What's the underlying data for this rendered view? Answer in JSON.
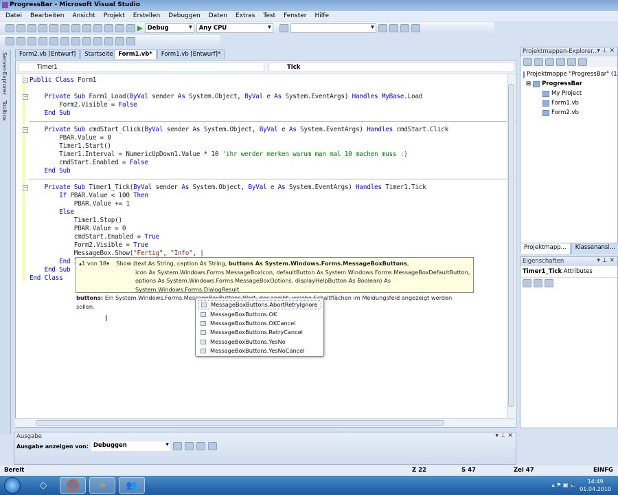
{
  "window": {
    "title": "ProgressBar - Microsoft Visual Studio"
  },
  "menu": [
    "Datei",
    "Bearbeiten",
    "Ansicht",
    "Projekt",
    "Erstellen",
    "Debuggen",
    "Daten",
    "Extras",
    "Test",
    "Fenster",
    "Hilfe"
  ],
  "toolbar": {
    "config": "Debug",
    "platform": "Any CPU"
  },
  "left_strip": [
    "Server-Explorer",
    "Toolbox"
  ],
  "tabs": [
    {
      "label": "Form2.vb [Entwurf]",
      "active": false
    },
    {
      "label": "Startseite",
      "active": false
    },
    {
      "label": "Form1.vb*",
      "active": true
    },
    {
      "label": "Form1.vb [Entwurf]*",
      "active": false
    }
  ],
  "editor": {
    "class_combo": "Timer1",
    "method_combo": "Tick",
    "lines": [
      [
        [
          "Public Class ",
          "kw"
        ],
        [
          "Form1",
          ""
        ]
      ],
      [],
      [
        [
          "    ",
          ""
        ],
        [
          "Private Sub ",
          "kw"
        ],
        [
          "Form1_Load(",
          ""
        ],
        [
          "ByVal ",
          "kw"
        ],
        [
          "sender ",
          ""
        ],
        [
          "As ",
          "kw"
        ],
        [
          "System.Object, ",
          ""
        ],
        [
          "ByVal ",
          "kw"
        ],
        [
          "e ",
          ""
        ],
        [
          "As ",
          "kw"
        ],
        [
          "System.EventArgs) ",
          ""
        ],
        [
          "Handles ",
          "kw"
        ],
        [
          "MyBase",
          "kw"
        ],
        [
          ".Load",
          ""
        ]
      ],
      [
        [
          "        Form2.Visible = ",
          ""
        ],
        [
          "False",
          "kw"
        ]
      ],
      [
        [
          "    ",
          ""
        ],
        [
          "End Sub",
          "kw"
        ]
      ],
      [],
      [
        [
          "    ",
          ""
        ],
        [
          "Private Sub ",
          "kw"
        ],
        [
          "cmdStart_Click(",
          ""
        ],
        [
          "ByVal ",
          "kw"
        ],
        [
          "sender ",
          ""
        ],
        [
          "As ",
          "kw"
        ],
        [
          "System.Object, ",
          ""
        ],
        [
          "ByVal ",
          "kw"
        ],
        [
          "e ",
          ""
        ],
        [
          "As ",
          "kw"
        ],
        [
          "System.EventArgs) ",
          ""
        ],
        [
          "Handles ",
          "kw"
        ],
        [
          "cmdStart.Click",
          ""
        ]
      ],
      [
        [
          "        PBAR.Value = 0",
          ""
        ]
      ],
      [
        [
          "        Timer1.Start()",
          ""
        ]
      ],
      [
        [
          "        Timer1.Interval = NumericUpDown1.Value * 10 ",
          ""
        ],
        [
          "'ihr werder merken warum man mal 10 machen muss :)",
          "cm"
        ]
      ],
      [
        [
          "        cmdStart.Enabled = ",
          ""
        ],
        [
          "False",
          "kw"
        ]
      ],
      [
        [
          "    ",
          ""
        ],
        [
          "End Sub",
          "kw"
        ]
      ],
      [],
      [
        [
          "    ",
          ""
        ],
        [
          "Private Sub ",
          "kw"
        ],
        [
          "Timer1_Tick(",
          ""
        ],
        [
          "ByVal ",
          "kw"
        ],
        [
          "sender ",
          ""
        ],
        [
          "As ",
          "kw"
        ],
        [
          "System.Object, ",
          ""
        ],
        [
          "ByVal ",
          "kw"
        ],
        [
          "e ",
          ""
        ],
        [
          "As ",
          "kw"
        ],
        [
          "System.EventArgs) ",
          ""
        ],
        [
          "Handles ",
          "kw"
        ],
        [
          "Timer1.Tick",
          ""
        ]
      ],
      [
        [
          "        ",
          ""
        ],
        [
          "If ",
          "kw"
        ],
        [
          "PBAR.Value < 100 ",
          ""
        ],
        [
          "Then",
          "kw"
        ]
      ],
      [
        [
          "            PBAR.Value += 1",
          ""
        ]
      ],
      [
        [
          "        ",
          ""
        ],
        [
          "Else",
          "kw"
        ]
      ],
      [
        [
          "            Timer1.Stop()",
          ""
        ]
      ],
      [
        [
          "            PBAR.Value = 0",
          ""
        ]
      ],
      [
        [
          "            cmdStart.Enabled = ",
          ""
        ],
        [
          "True",
          "kw"
        ]
      ],
      [
        [
          "            Form2.Visible = ",
          ""
        ],
        [
          "True",
          "kw"
        ]
      ],
      [
        [
          "            MessageBox.Show(",
          ""
        ],
        [
          "\"Fertig\"",
          "st"
        ],
        [
          ", ",
          ""
        ],
        [
          "\"Info\"",
          "st"
        ],
        [
          ", |",
          ""
        ]
      ],
      [
        [
          "        ",
          ""
        ],
        [
          "End If",
          "kw"
        ]
      ],
      [
        [
          "    ",
          ""
        ],
        [
          "End Sub",
          "kw"
        ]
      ],
      [
        [
          "End Class",
          "kw"
        ]
      ]
    ]
  },
  "tooltip": {
    "counter": "1 von 18",
    "line1_a": "Show (text As String, caption As String, ",
    "line1_b": "buttons As System.Windows.Forms.MessageBoxButtons",
    "line1_c": ",",
    "line2": "icon As System.Windows.Forms.MessageBoxIcon, defaultButton As System.Windows.Forms.MessageBoxDefaultButton,",
    "line3": "options As System.Windows.Forms.MessageBoxOptions, displayHelpButton As Boolean) As System.Windows.Forms.DialogResult",
    "param_name": "buttons:",
    "param_desc": " Ein System.Windows.Forms.MessageBoxButtons-Wert, der angibt, welche Schaltflächen im Meldungsfeld angezeigt werden sollen."
  },
  "completion": [
    "MessageBoxButtons.AbortRetryIgnore",
    "MessageBoxButtons.OK",
    "MessageBoxButtons.OKCancel",
    "MessageBoxButtons.RetryCancel",
    "MessageBoxButtons.YesNo",
    "MessageBoxButtons.YesNoCancel"
  ],
  "output": {
    "title": "Ausgabe",
    "show_label": "Ausgabe anzeigen von:",
    "source": "Debuggen"
  },
  "solution_explorer": {
    "title": "Projektmappen-Explorer...",
    "items": [
      "Projektmappe \"ProgressBar\" (1",
      "ProgressBar",
      "My Project",
      "Form1.vb",
      "Form2.vb"
    ],
    "tabs": [
      "Projektmapp...",
      "Klassenansi..."
    ]
  },
  "properties": {
    "title": "Eigenschaften",
    "object": "Timer1_Tick",
    "object_type": "Attributes"
  },
  "status": {
    "text": "Bereit",
    "line": "Z 22",
    "col": "S 47",
    "char": "Zei 47",
    "mode": "EINFG"
  },
  "taskbar": {
    "time": "14:49",
    "date": "01.04.2010"
  }
}
